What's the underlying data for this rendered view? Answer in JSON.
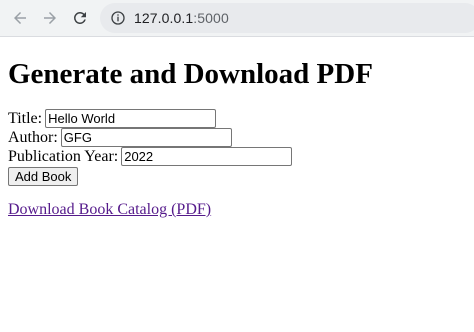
{
  "browser": {
    "url_host": "127.0.0.1",
    "url_port": ":5000"
  },
  "page": {
    "title": "Generate and Download PDF",
    "form": {
      "title_label": "Title:",
      "title_value": "Hello World",
      "author_label": "Author:",
      "author_value": "GFG",
      "year_label": "Publication Year:",
      "year_value": "2022",
      "submit_label": "Add Book"
    },
    "download_link": "Download Book Catalog (PDF)"
  },
  "colors": {
    "toolbar_bg": "#f1f3f4",
    "omnibox_bg": "#e8eaed",
    "visited_link": "#551a8b"
  }
}
